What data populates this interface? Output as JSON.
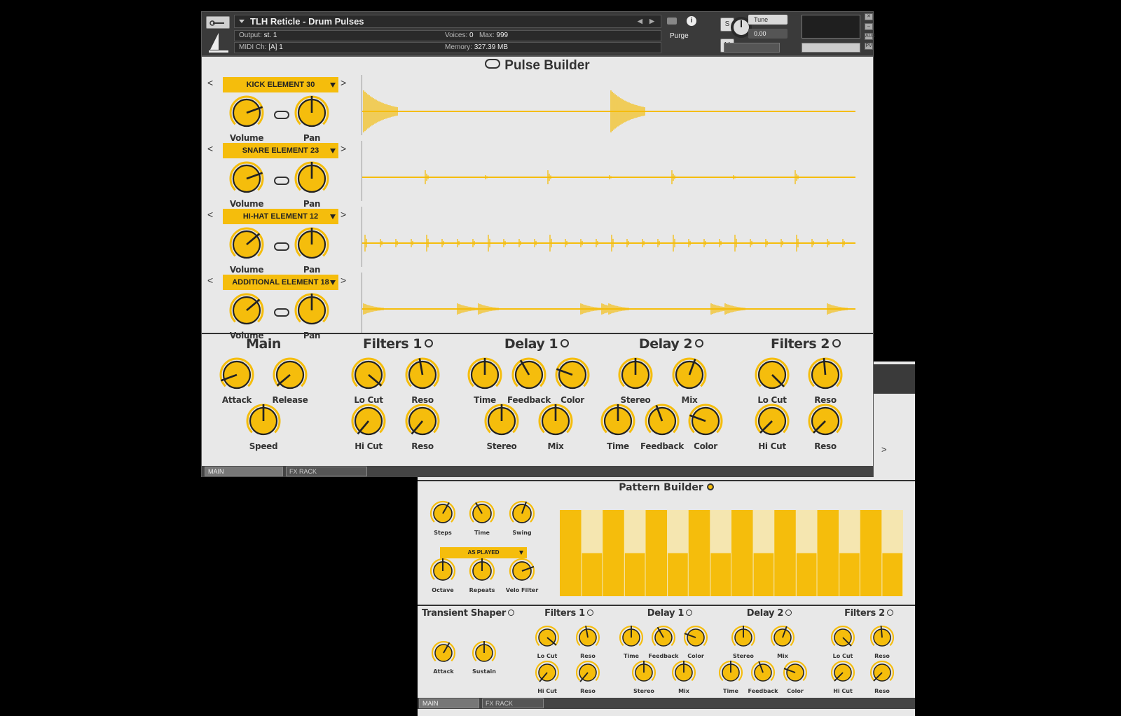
{
  "window1": {
    "instrument_name": "TLH Reticle - Drum Pulses",
    "output_label": "Output:",
    "output_value": "st. 1",
    "midi_label": "MIDI Ch:",
    "midi_value": "[A] 1",
    "voices_label": "Voices:",
    "voices_value": "0",
    "max_label": "Max:",
    "max_value": "999",
    "memory_label": "Memory:",
    "memory_value": "327.39 MB",
    "purge_label": "Purge",
    "s_label": "S",
    "m_label": "M",
    "tune_label": "Tune",
    "tune_value": "0.00",
    "aux_label": "AUX",
    "pv_label": "PV",
    "page_title": "Pulse Builder",
    "elements": [
      {
        "name": "KICK ELEMENT 30",
        "volume_label": "Volume",
        "pan_label": "Pan"
      },
      {
        "name": "SNARE ELEMENT 23",
        "volume_label": "Volume",
        "pan_label": "Pan"
      },
      {
        "name": "HI-HAT ELEMENT 12",
        "volume_label": "Volume",
        "pan_label": "Pan"
      },
      {
        "name": "ADDITIONAL ELEMENT 18",
        "volume_label": "Volume",
        "pan_label": "Pan"
      }
    ],
    "prev_arrow": "<",
    "next_arrow": ">",
    "sections": {
      "main": {
        "title": "Main",
        "knobs": [
          "Attack",
          "Release",
          "Speed"
        ]
      },
      "filters1": {
        "title": "Filters 1",
        "knobs": [
          "Lo Cut",
          "Reso",
          "Hi Cut",
          "Reso"
        ]
      },
      "delay1": {
        "title": "Delay 1",
        "knobs": [
          "Time",
          "Feedback",
          "Color",
          "Stereo",
          "Mix"
        ]
      },
      "delay2": {
        "title": "Delay 2",
        "knobs": [
          "Stereo",
          "Mix",
          "Time",
          "Feedback",
          "Color"
        ]
      },
      "filters2": {
        "title": "Filters 2",
        "knobs": [
          "Lo Cut",
          "Reso",
          "Hi Cut",
          "Reso"
        ]
      }
    },
    "tabs": [
      "MAIN",
      "FX RACK"
    ]
  },
  "window2": {
    "page_title": "Pattern Builder",
    "knobs_top": [
      "Steps",
      "Time",
      "Swing"
    ],
    "mode_select": "AS PLAYED",
    "knobs_bottom": [
      "Octave",
      "Repeats",
      "Velo Filter"
    ],
    "pattern_steps": [
      1,
      0.5,
      1,
      0.5,
      1,
      0.5,
      1,
      0.5,
      1,
      0.5,
      1,
      0.5,
      1,
      0.5,
      1,
      0.5
    ],
    "sections": {
      "transient": {
        "title": "Transient Shaper",
        "knobs": [
          "Attack",
          "Sustain"
        ]
      },
      "filters1": {
        "title": "Filters 1",
        "knobs": [
          "Lo Cut",
          "Reso",
          "Hi Cut",
          "Reso"
        ]
      },
      "delay1": {
        "title": "Delay 1",
        "knobs": [
          "Time",
          "Feedback",
          "Color",
          "Stereo",
          "Mix"
        ]
      },
      "delay2": {
        "title": "Delay 2",
        "knobs": [
          "Stereo",
          "Mix",
          "Time",
          "Feedback",
          "Color"
        ]
      },
      "filters2": {
        "title": "Filters 2",
        "knobs": [
          "Lo Cut",
          "Reso",
          "Hi Cut",
          "Reso"
        ]
      }
    },
    "tabs": [
      "MAIN",
      "FX RACK"
    ]
  },
  "colors": {
    "accent": "#f5bd0c",
    "accent_light": "#f5e6b0",
    "panel": "#e8e8e8",
    "dark": "#333333"
  }
}
